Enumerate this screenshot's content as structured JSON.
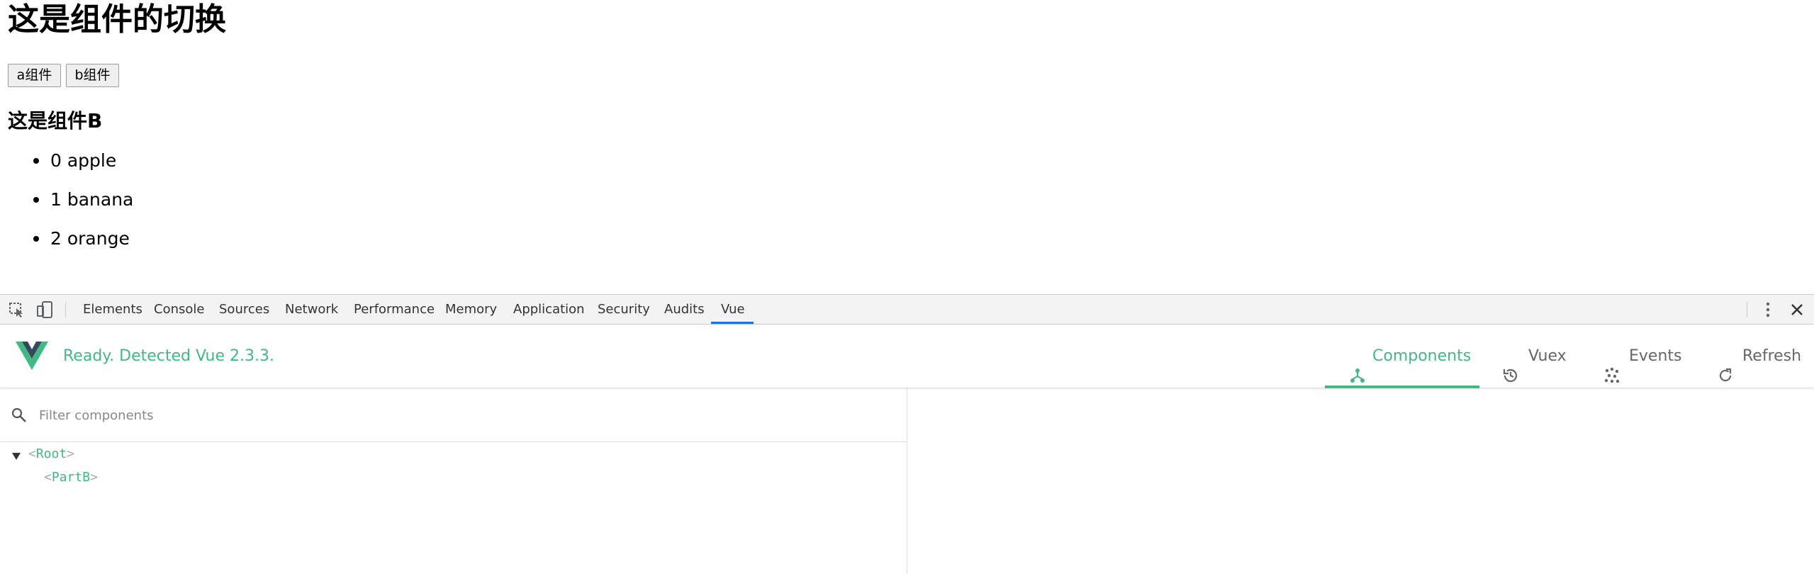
{
  "page": {
    "title": "这是组件的切换",
    "buttons": [
      {
        "label": "a组件"
      },
      {
        "label": "b组件"
      }
    ],
    "component_heading": "这是组件B",
    "list": [
      {
        "text": "0 apple"
      },
      {
        "text": "1 banana"
      },
      {
        "text": "2 orange"
      }
    ]
  },
  "devtools": {
    "tabs": [
      {
        "label": "Elements"
      },
      {
        "label": "Console"
      },
      {
        "label": "Sources"
      },
      {
        "label": "Network"
      },
      {
        "label": "Performance"
      },
      {
        "label": "Memory"
      },
      {
        "label": "Application"
      },
      {
        "label": "Security"
      },
      {
        "label": "Audits"
      },
      {
        "label": "Vue"
      }
    ],
    "active_tab": "Vue",
    "vue": {
      "status": "Ready. Detected Vue 2.3.3.",
      "actions": [
        {
          "label": "Components",
          "icon": "components-icon",
          "active": true
        },
        {
          "label": "Vuex",
          "icon": "history-icon",
          "active": false
        },
        {
          "label": "Events",
          "icon": "events-icon",
          "active": false
        },
        {
          "label": "Refresh",
          "icon": "refresh-icon",
          "active": false
        }
      ],
      "filter_placeholder": "Filter components",
      "tree": [
        {
          "open": "<",
          "name": "Root",
          "close": ">"
        },
        {
          "open": "<",
          "name": "PartB",
          "close": ">"
        }
      ]
    },
    "colors": {
      "vue_green": "#42b983",
      "tab_accent": "#1a73e8"
    }
  }
}
